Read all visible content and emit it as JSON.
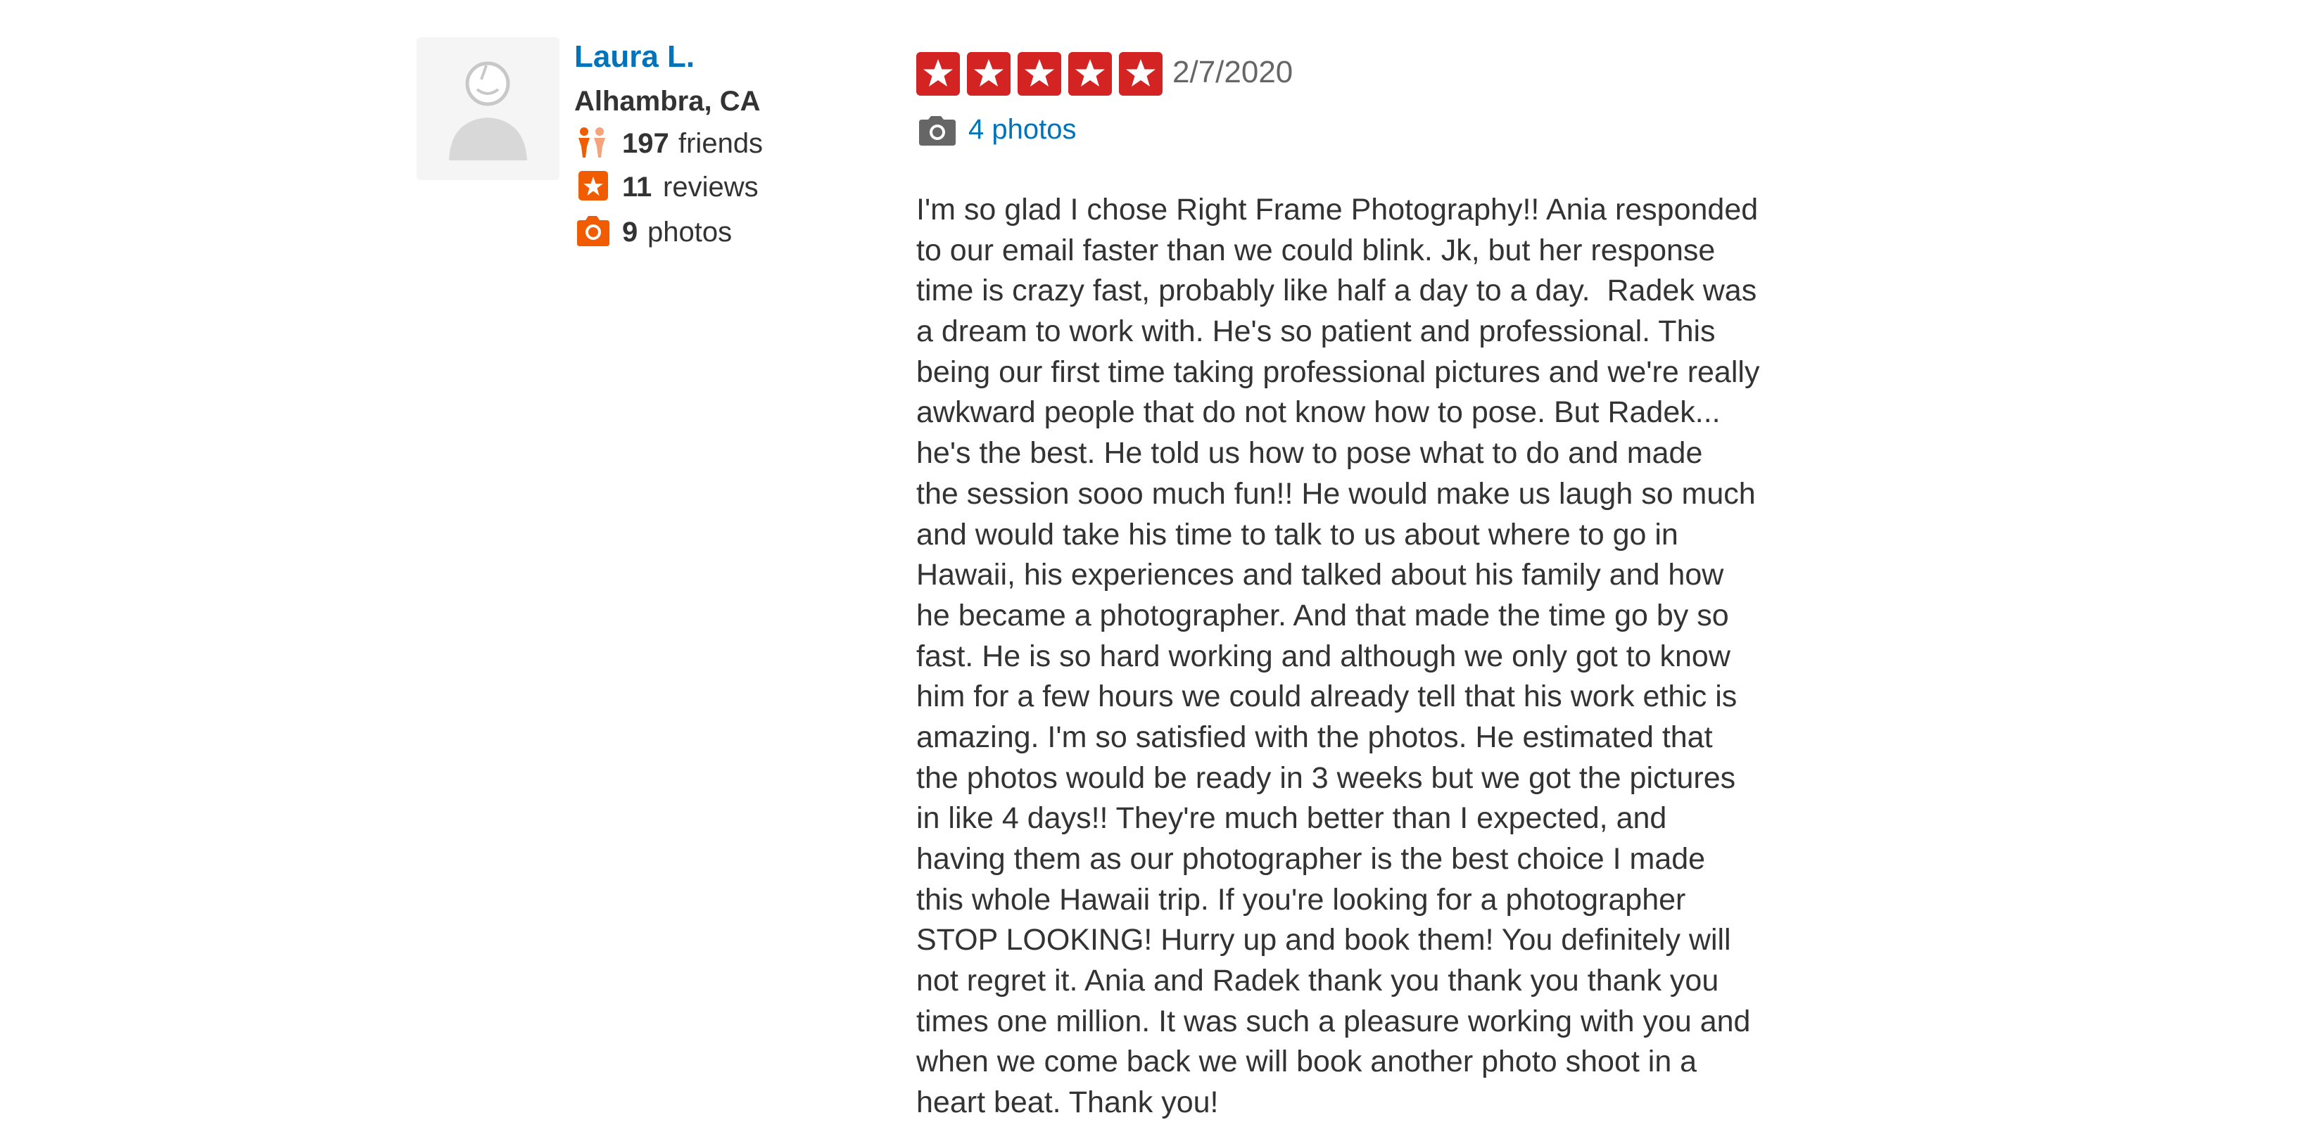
{
  "user": {
    "name": "Laura L.",
    "location": "Alhambra, CA",
    "friends_count": "197",
    "friends_label": "friends",
    "reviews_count": "11",
    "reviews_label": "reviews",
    "photos_count": "9",
    "photos_label": "photos"
  },
  "review": {
    "rating_value": 5,
    "date": "2/7/2020",
    "photos_link": "4 photos",
    "text_lines": [
      "I'm so glad I chose Right Frame Photography!! Ania responded",
      "to our email faster than we could blink. Jk, but her response",
      "time is crazy fast, probably like half a day to a day.  Radek was",
      "a dream to work with. He's so patient and professional. This",
      "being our first time taking professional pictures and we're really",
      "awkward people that do not know how to pose. But Radek...",
      "he's the best. He told us how to pose what to do and made",
      "the session sooo much fun!! He would make us laugh so much",
      "and would take his time to talk to us about where to go in",
      "Hawaii, his experiences and talked about his family and how",
      "he became a photographer. And that made the time go by so",
      "fast. He is so hard working and although we only got to know",
      "him for a few hours we could already tell that his work ethic is",
      "amazing. I'm so satisfied with the photos. He estimated that",
      "the photos would be ready in 3 weeks but we got the pictures",
      "in like 4 days!! They're much better than I expected, and",
      "having them as our photographer is the best choice I made",
      "this whole Hawaii trip. If you're looking for a photographer",
      "STOP LOOKING! Hurry up and book them! You definitely will",
      "not regret it. Ania and Radek thank you thank you thank you",
      "times one million. It was such a pleasure working with you and",
      "when we come back we will book another photo shoot in a",
      "heart beat. Thank you!"
    ]
  },
  "icons": {
    "avatar": "default-user-avatar-icon",
    "friends": "friends-icon",
    "reviews": "star-review-icon",
    "photos": "camera-icon",
    "rating_star": "star-icon",
    "photos_link": "camera-icon"
  },
  "colors": {
    "link_blue": "#0073bb",
    "star_red": "#d32323",
    "icon_orange": "#f15c00",
    "text_dark": "#333333",
    "date_gray": "#666666"
  }
}
